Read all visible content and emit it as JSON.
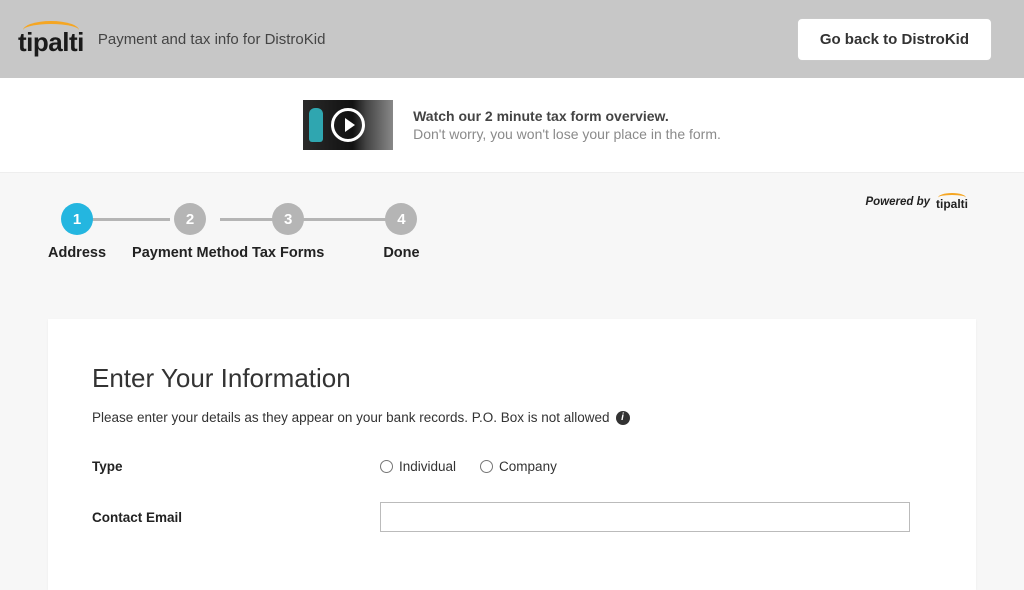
{
  "header": {
    "logo_text": "tipalti",
    "subtitle": "Payment and tax info for DistroKid",
    "go_back_label": "Go back to DistroKid"
  },
  "video_banner": {
    "title": "Watch our 2 minute tax form overview.",
    "subtitle": "Don't worry, you won't lose your place in the form."
  },
  "steps": [
    {
      "num": "1",
      "label": "Address",
      "active": true
    },
    {
      "num": "2",
      "label": "Payment Method",
      "active": false
    },
    {
      "num": "3",
      "label": "Tax Forms",
      "active": false
    },
    {
      "num": "4",
      "label": "Done",
      "active": false
    }
  ],
  "powered_by": {
    "prefix": "Powered by",
    "brand": "tipalti"
  },
  "form": {
    "title": "Enter Your Information",
    "description": "Please enter your details as they appear on your bank records. P.O. Box is not allowed",
    "type_label": "Type",
    "type_options": {
      "individual": "Individual",
      "company": "Company"
    },
    "email_label": "Contact Email",
    "email_value": ""
  }
}
